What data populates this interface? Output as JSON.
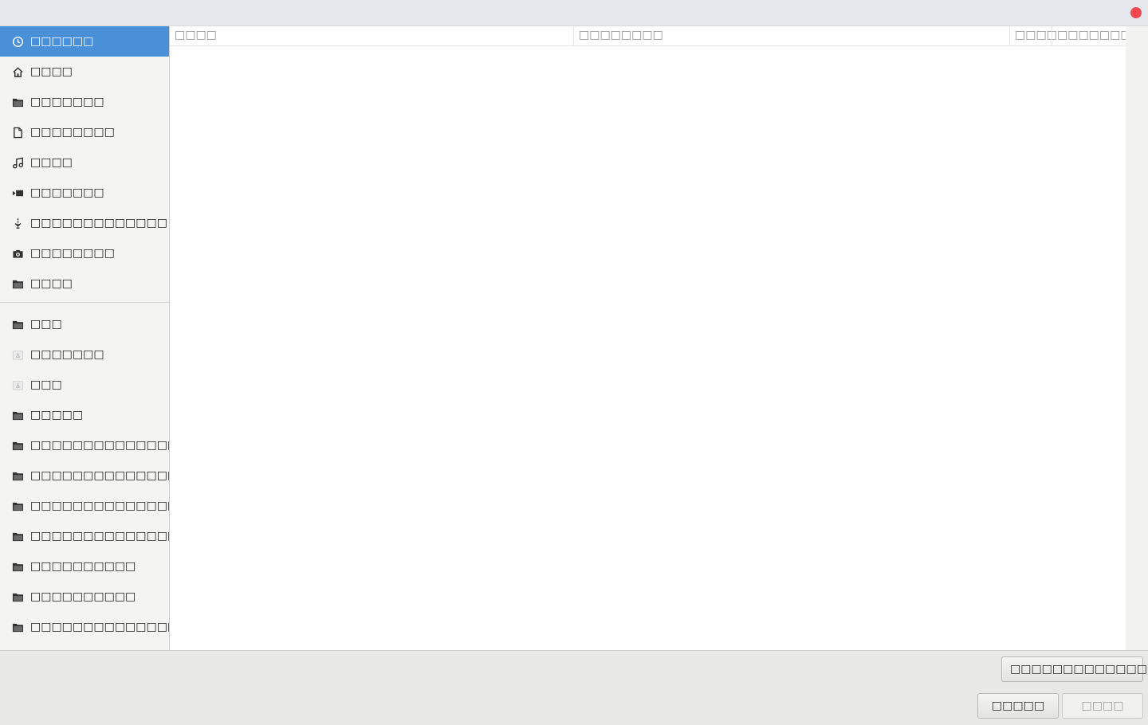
{
  "window": {
    "close_icon": "close-icon",
    "accent": "#4a90d9",
    "close_color": "#f04a50"
  },
  "sidebar": {
    "places": [
      {
        "label": "□□□□□□",
        "icon": "recent-icon",
        "selected": true
      },
      {
        "label": "□□□□",
        "icon": "home-icon"
      },
      {
        "label": "□□□□□□□",
        "icon": "folder-icon"
      },
      {
        "label": "□□□□□□□□",
        "icon": "document-icon"
      },
      {
        "label": "□□□□",
        "icon": "music-icon"
      },
      {
        "label": "□□□□□□□",
        "icon": "video-icon"
      },
      {
        "label": "□□□□□□□□□□□□□",
        "icon": "download-icon"
      },
      {
        "label": "□□□□□□□□",
        "icon": "camera-icon"
      },
      {
        "label": "□□□□",
        "icon": "folder-icon"
      }
    ],
    "bookmarks": [
      {
        "label": "□□□",
        "icon": "folder-icon"
      },
      {
        "label": "□□□□□□□",
        "icon": "drive-icon"
      },
      {
        "label": "□□□",
        "icon": "drive-icon"
      },
      {
        "label": "□□□□□",
        "icon": "folder-icon"
      },
      {
        "label": "□□□□□□□□□□□□□□□",
        "icon": "folder-icon"
      },
      {
        "label": "□□□□□□□□□□□□□□□",
        "icon": "folder-icon"
      },
      {
        "label": "□□□□□□□□□□□□□□□",
        "icon": "folder-icon"
      },
      {
        "label": "□□□□□□□□□□□□□□□",
        "icon": "folder-icon"
      },
      {
        "label": "□□□□□□□□□□",
        "icon": "folder-icon"
      },
      {
        "label": "□□□□□□□□□□",
        "icon": "folder-icon"
      },
      {
        "label": "□□□□□□□□□□□□□□□",
        "icon": "folder-icon"
      }
    ]
  },
  "file_list": {
    "columns": {
      "name": "□□□□",
      "location": "□□□□□□□□",
      "size": "□□□□",
      "modified": "□□□□□□□□"
    }
  },
  "footer": {
    "filter_label": "□□□□□□□□□□□□□□",
    "cancel_label": "□□□□□",
    "open_label": "□□□□"
  }
}
